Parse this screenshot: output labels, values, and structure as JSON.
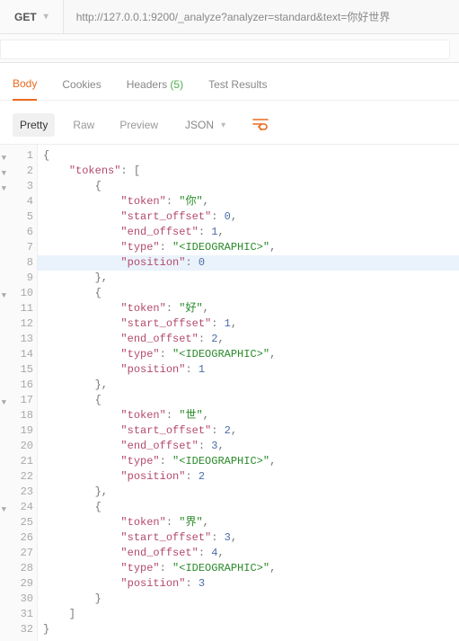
{
  "request": {
    "method": "GET",
    "url": "http://127.0.0.1:9200/_analyze?analyzer=standard&text=你好世界"
  },
  "tabs": {
    "body": "Body",
    "cookies": "Cookies",
    "headers": "Headers",
    "headers_count": "(5)",
    "tests": "Test Results"
  },
  "view": {
    "pretty": "Pretty",
    "raw": "Raw",
    "preview": "Preview",
    "format": "JSON"
  },
  "highlight_line": 8,
  "foldable_lines": [
    1,
    2,
    3,
    10,
    17,
    24
  ],
  "code_lines": [
    [
      {
        "c": "pun",
        "t": "{"
      }
    ],
    [
      {
        "c": "pun",
        "t": "    "
      },
      {
        "c": "key",
        "t": "\"tokens\""
      },
      {
        "c": "pun",
        "t": ": ["
      }
    ],
    [
      {
        "c": "pun",
        "t": "        {"
      }
    ],
    [
      {
        "c": "pun",
        "t": "            "
      },
      {
        "c": "key",
        "t": "\"token\""
      },
      {
        "c": "pun",
        "t": ": "
      },
      {
        "c": "str",
        "t": "\"你\""
      },
      {
        "c": "pun",
        "t": ","
      }
    ],
    [
      {
        "c": "pun",
        "t": "            "
      },
      {
        "c": "key",
        "t": "\"start_offset\""
      },
      {
        "c": "pun",
        "t": ": "
      },
      {
        "c": "num",
        "t": "0"
      },
      {
        "c": "pun",
        "t": ","
      }
    ],
    [
      {
        "c": "pun",
        "t": "            "
      },
      {
        "c": "key",
        "t": "\"end_offset\""
      },
      {
        "c": "pun",
        "t": ": "
      },
      {
        "c": "num",
        "t": "1"
      },
      {
        "c": "pun",
        "t": ","
      }
    ],
    [
      {
        "c": "pun",
        "t": "            "
      },
      {
        "c": "key",
        "t": "\"type\""
      },
      {
        "c": "pun",
        "t": ": "
      },
      {
        "c": "str",
        "t": "\"<IDEOGRAPHIC>\""
      },
      {
        "c": "pun",
        "t": ","
      }
    ],
    [
      {
        "c": "pun",
        "t": "            "
      },
      {
        "c": "key",
        "t": "\"position\""
      },
      {
        "c": "pun",
        "t": ": "
      },
      {
        "c": "num",
        "t": "0"
      }
    ],
    [
      {
        "c": "pun",
        "t": "        },"
      }
    ],
    [
      {
        "c": "pun",
        "t": "        {"
      }
    ],
    [
      {
        "c": "pun",
        "t": "            "
      },
      {
        "c": "key",
        "t": "\"token\""
      },
      {
        "c": "pun",
        "t": ": "
      },
      {
        "c": "str",
        "t": "\"好\""
      },
      {
        "c": "pun",
        "t": ","
      }
    ],
    [
      {
        "c": "pun",
        "t": "            "
      },
      {
        "c": "key",
        "t": "\"start_offset\""
      },
      {
        "c": "pun",
        "t": ": "
      },
      {
        "c": "num",
        "t": "1"
      },
      {
        "c": "pun",
        "t": ","
      }
    ],
    [
      {
        "c": "pun",
        "t": "            "
      },
      {
        "c": "key",
        "t": "\"end_offset\""
      },
      {
        "c": "pun",
        "t": ": "
      },
      {
        "c": "num",
        "t": "2"
      },
      {
        "c": "pun",
        "t": ","
      }
    ],
    [
      {
        "c": "pun",
        "t": "            "
      },
      {
        "c": "key",
        "t": "\"type\""
      },
      {
        "c": "pun",
        "t": ": "
      },
      {
        "c": "str",
        "t": "\"<IDEOGRAPHIC>\""
      },
      {
        "c": "pun",
        "t": ","
      }
    ],
    [
      {
        "c": "pun",
        "t": "            "
      },
      {
        "c": "key",
        "t": "\"position\""
      },
      {
        "c": "pun",
        "t": ": "
      },
      {
        "c": "num",
        "t": "1"
      }
    ],
    [
      {
        "c": "pun",
        "t": "        },"
      }
    ],
    [
      {
        "c": "pun",
        "t": "        {"
      }
    ],
    [
      {
        "c": "pun",
        "t": "            "
      },
      {
        "c": "key",
        "t": "\"token\""
      },
      {
        "c": "pun",
        "t": ": "
      },
      {
        "c": "str",
        "t": "\"世\""
      },
      {
        "c": "pun",
        "t": ","
      }
    ],
    [
      {
        "c": "pun",
        "t": "            "
      },
      {
        "c": "key",
        "t": "\"start_offset\""
      },
      {
        "c": "pun",
        "t": ": "
      },
      {
        "c": "num",
        "t": "2"
      },
      {
        "c": "pun",
        "t": ","
      }
    ],
    [
      {
        "c": "pun",
        "t": "            "
      },
      {
        "c": "key",
        "t": "\"end_offset\""
      },
      {
        "c": "pun",
        "t": ": "
      },
      {
        "c": "num",
        "t": "3"
      },
      {
        "c": "pun",
        "t": ","
      }
    ],
    [
      {
        "c": "pun",
        "t": "            "
      },
      {
        "c": "key",
        "t": "\"type\""
      },
      {
        "c": "pun",
        "t": ": "
      },
      {
        "c": "str",
        "t": "\"<IDEOGRAPHIC>\""
      },
      {
        "c": "pun",
        "t": ","
      }
    ],
    [
      {
        "c": "pun",
        "t": "            "
      },
      {
        "c": "key",
        "t": "\"position\""
      },
      {
        "c": "pun",
        "t": ": "
      },
      {
        "c": "num",
        "t": "2"
      }
    ],
    [
      {
        "c": "pun",
        "t": "        },"
      }
    ],
    [
      {
        "c": "pun",
        "t": "        {"
      }
    ],
    [
      {
        "c": "pun",
        "t": "            "
      },
      {
        "c": "key",
        "t": "\"token\""
      },
      {
        "c": "pun",
        "t": ": "
      },
      {
        "c": "str",
        "t": "\"界\""
      },
      {
        "c": "pun",
        "t": ","
      }
    ],
    [
      {
        "c": "pun",
        "t": "            "
      },
      {
        "c": "key",
        "t": "\"start_offset\""
      },
      {
        "c": "pun",
        "t": ": "
      },
      {
        "c": "num",
        "t": "3"
      },
      {
        "c": "pun",
        "t": ","
      }
    ],
    [
      {
        "c": "pun",
        "t": "            "
      },
      {
        "c": "key",
        "t": "\"end_offset\""
      },
      {
        "c": "pun",
        "t": ": "
      },
      {
        "c": "num",
        "t": "4"
      },
      {
        "c": "pun",
        "t": ","
      }
    ],
    [
      {
        "c": "pun",
        "t": "            "
      },
      {
        "c": "key",
        "t": "\"type\""
      },
      {
        "c": "pun",
        "t": ": "
      },
      {
        "c": "str",
        "t": "\"<IDEOGRAPHIC>\""
      },
      {
        "c": "pun",
        "t": ","
      }
    ],
    [
      {
        "c": "pun",
        "t": "            "
      },
      {
        "c": "key",
        "t": "\"position\""
      },
      {
        "c": "pun",
        "t": ": "
      },
      {
        "c": "num",
        "t": "3"
      }
    ],
    [
      {
        "c": "pun",
        "t": "        }"
      }
    ],
    [
      {
        "c": "pun",
        "t": "    ]"
      }
    ],
    [
      {
        "c": "pun",
        "t": "}"
      }
    ]
  ]
}
